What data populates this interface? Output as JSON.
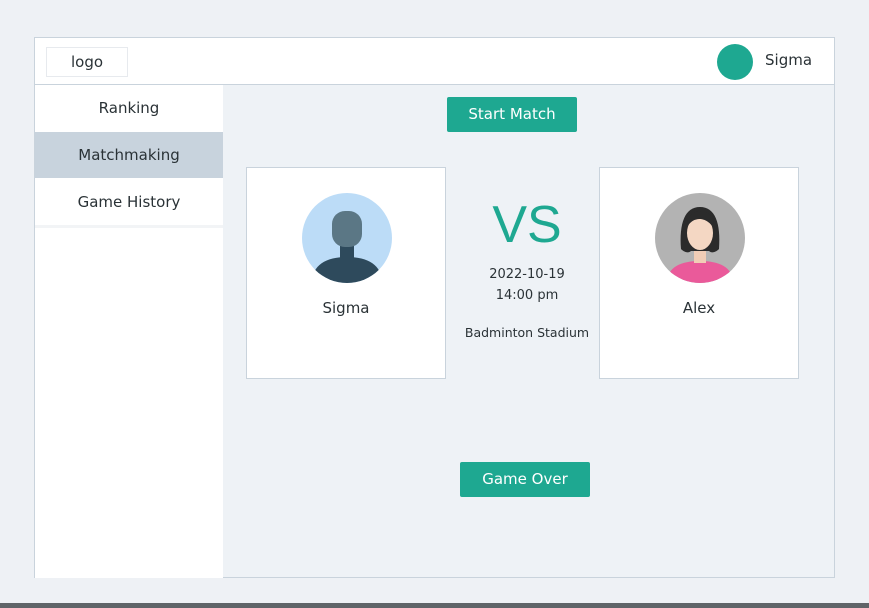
{
  "header": {
    "logo_text": "logo",
    "user_name": "Sigma"
  },
  "sidebar": {
    "items": [
      {
        "label": "Ranking",
        "active": false
      },
      {
        "label": "Matchmaking",
        "active": true
      },
      {
        "label": "Game History",
        "active": false
      }
    ]
  },
  "main": {
    "start_button": "Start Match",
    "game_over_button": "Game Over",
    "vs_text": "VS",
    "match": {
      "date": "2022-10-19",
      "time": "14:00 pm",
      "venue": "Badminton Stadium"
    },
    "players": [
      {
        "name": "Sigma",
        "avatar": "male-avatar-icon"
      },
      {
        "name": "Alex",
        "avatar": "female-avatar-icon"
      }
    ]
  },
  "colors": {
    "accent": "#1ea891",
    "active_nav": "#c8d3dd",
    "background": "#eef2f6"
  }
}
